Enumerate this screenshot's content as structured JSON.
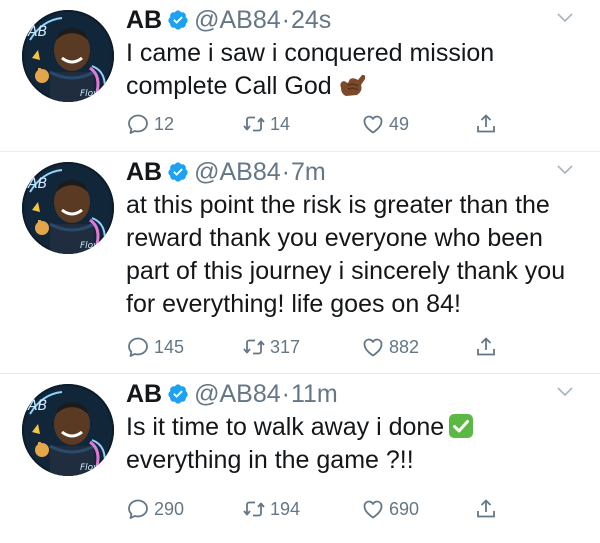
{
  "tweets": [
    {
      "name": "AB",
      "handle": "@AB84",
      "separator": "·",
      "time": "24s",
      "text": "I came i saw i conquered mission complete Call God",
      "emoji": "call-me-hand",
      "replies": "12",
      "retweets": "14",
      "likes": "49"
    },
    {
      "name": "AB",
      "handle": "@AB84",
      "separator": "·",
      "time": "7m",
      "text": "at this point the risk is greater than the reward thank you everyone who been part of this journey i sincerely thank you for everything! life goes on 84!",
      "replies": "145",
      "retweets": "317",
      "likes": "882"
    },
    {
      "name": "AB",
      "handle": "@AB84",
      "separator": "·",
      "time": "11m",
      "text_before_emoji": "Is it time to walk away i done",
      "emoji": "white-check-mark",
      "text_after_emoji": "everything in the game ?!!",
      "replies": "290",
      "retweets": "194",
      "likes": "690"
    }
  ],
  "colors": {
    "verified": "#1da1f2",
    "secondary_text": "#657786",
    "divider": "#e6ecf0",
    "check_emoji": "#5bb842"
  }
}
